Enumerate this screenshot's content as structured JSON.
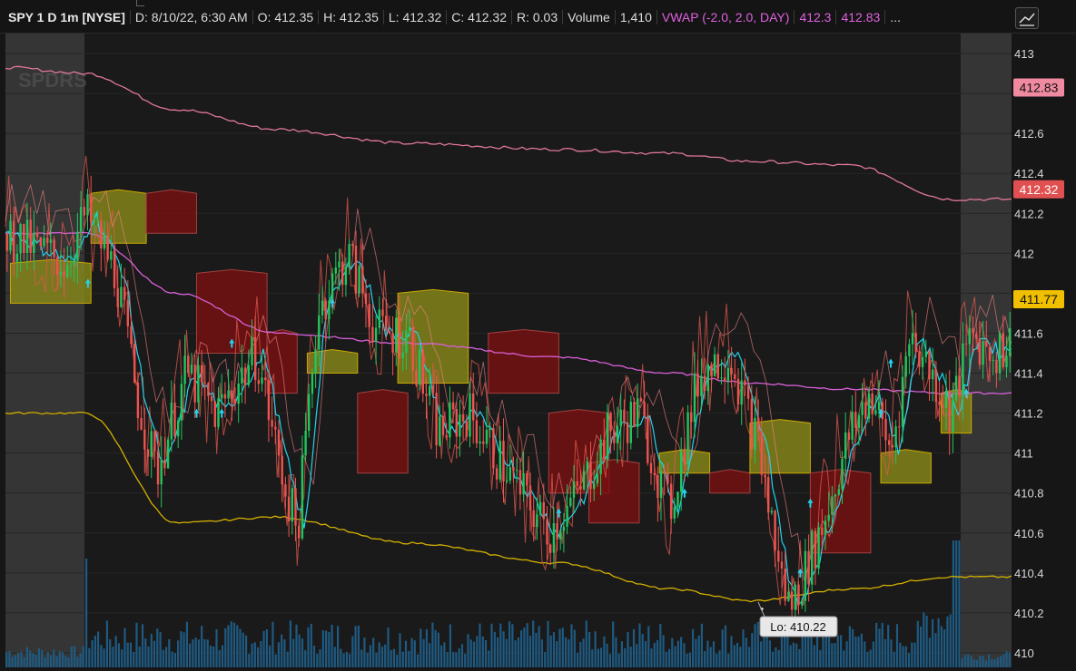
{
  "header": {
    "symbol": "SPY 1 D 1m [NYSE]",
    "date": "D: 8/10/22, 6:30 AM",
    "open": "O: 412.35",
    "high": "H: 412.35",
    "low": "L: 412.32",
    "close": "C: 412.32",
    "range": "R: 0.03",
    "volume_label": "Volume",
    "volume_value": "1,410",
    "vwap_label": "VWAP (-2.0, 2.0, DAY)",
    "vwap_value": "412.3",
    "vwap_upper": "412.83",
    "more": "..."
  },
  "watermark": "SPDRS",
  "price_badges": {
    "vwap_upper": "412.83",
    "last": "412.32",
    "lower_band_val": "411.77"
  },
  "low_label": "Lo: 410.22",
  "colors": {
    "up": "#22c55e",
    "down": "#ef5350",
    "vwap": "#d860d8",
    "upper_band": "#e07898",
    "lower_band": "#d4b000",
    "cyan": "#22d3ee",
    "volume": "#1e5a82",
    "cloud_bull": "#8a8a1a",
    "cloud_bear": "#7a1010"
  },
  "chart_data": {
    "type": "line",
    "title": "SPY 1 D 1m [NYSE]",
    "xlabel": "",
    "ylabel": "",
    "ylim": [
      410,
      413.1
    ],
    "y_ticks": [
      410,
      410.2,
      410.4,
      410.6,
      410.8,
      411,
      411.2,
      411.4,
      411.6,
      411.8,
      412,
      412.2,
      412.4,
      412.6,
      412.8,
      413
    ],
    "y_tick_labels": [
      "410",
      "410.2",
      "410.4",
      "410.6",
      "410.8",
      "411",
      "411.2",
      "411.4",
      "411.6",
      "",
      "412",
      "412.2",
      "412.4",
      "412.6",
      "",
      "413"
    ],
    "series": [
      {
        "name": "VWAP upper",
        "values": [
          412.93,
          412.9,
          412.72,
          412.62,
          412.55,
          412.52,
          412.5,
          412.46,
          412.44,
          412.27,
          412.27
        ]
      },
      {
        "name": "VWAP",
        "values": [
          412.1,
          412.1,
          411.8,
          411.6,
          411.55,
          411.48,
          411.4,
          411.35,
          411.32,
          411.3,
          411.3
        ]
      },
      {
        "name": "VWAP lower",
        "values": [
          411.2,
          411.2,
          410.65,
          410.68,
          410.55,
          410.45,
          410.32,
          410.26,
          410.32,
          410.38,
          410.38
        ]
      }
    ],
    "x_frac": [
      0.0,
      0.08,
      0.17,
      0.27,
      0.4,
      0.55,
      0.66,
      0.74,
      0.84,
      0.94,
      1.0
    ],
    "low_marker": 410.22
  }
}
